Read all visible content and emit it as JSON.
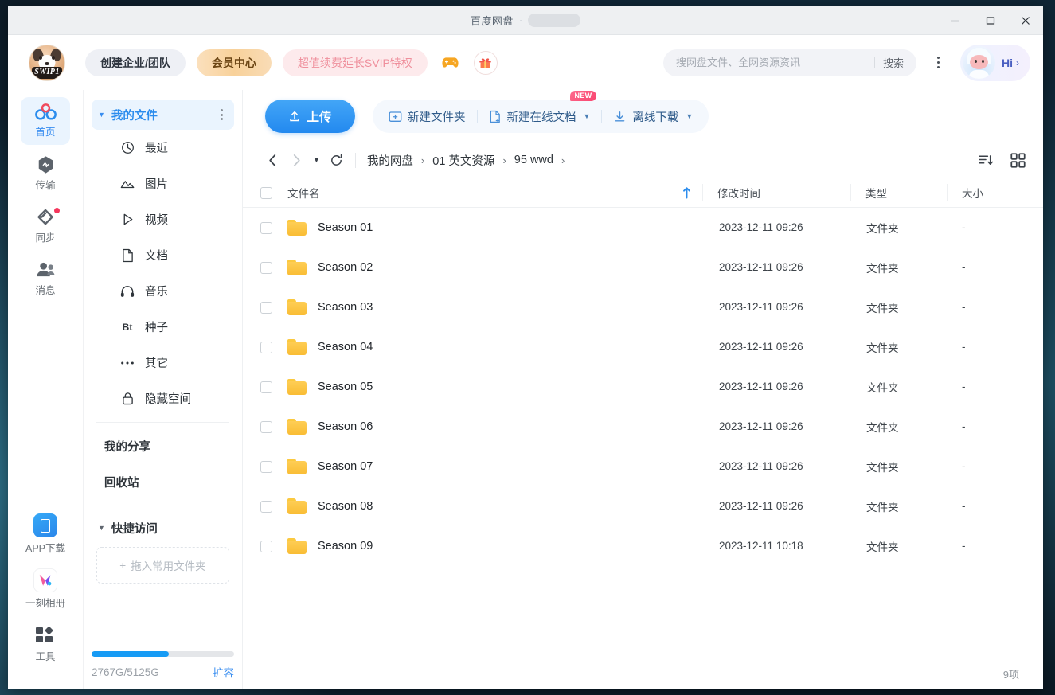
{
  "window": {
    "title": "百度网盘",
    "title_separator": "·",
    "title_redacted": true,
    "controls": {
      "minimize": "minimize-icon",
      "maximize": "maximize-icon",
      "close": "close-icon"
    }
  },
  "header": {
    "logo_text": "SWIP1",
    "buttons": [
      {
        "label": "创建企业/团队",
        "name": "create-team-button"
      },
      {
        "label": "会员中心",
        "name": "member-center-button"
      },
      {
        "label": "超值续费延长SVIP特权",
        "name": "svip-renew-button"
      }
    ],
    "game_icon": "gamepad-icon",
    "gift_icon": "gift-icon",
    "search": {
      "placeholder": "搜网盘文件、全网资源资讯",
      "value": "",
      "button_label": "搜索"
    },
    "more_label": "more-options",
    "user": {
      "greeting": "Hi",
      "arrow": "›"
    }
  },
  "rail": {
    "items": [
      {
        "label": "首页",
        "icon": "home-icon",
        "active": true,
        "badge": false
      },
      {
        "label": "传输",
        "icon": "transfer-icon",
        "active": false,
        "badge": false
      },
      {
        "label": "同步",
        "icon": "sync-icon",
        "active": false,
        "badge": true
      },
      {
        "label": "消息",
        "icon": "message-icon",
        "active": false,
        "badge": false
      }
    ],
    "bottom_items": [
      {
        "label": "APP下载",
        "icon": "app-download-icon"
      },
      {
        "label": "一刻相册",
        "icon": "album-icon"
      },
      {
        "label": "工具",
        "icon": "tools-icon"
      }
    ]
  },
  "sidebar": {
    "header": {
      "label": "我的文件",
      "expanded": true
    },
    "items": [
      {
        "label": "最近",
        "icon": "clock-icon"
      },
      {
        "label": "图片",
        "icon": "image-icon"
      },
      {
        "label": "视频",
        "icon": "video-icon"
      },
      {
        "label": "文档",
        "icon": "document-icon"
      },
      {
        "label": "音乐",
        "icon": "music-icon"
      },
      {
        "label": "种子",
        "icon": "bt-icon",
        "icon_text": "Bt"
      },
      {
        "label": "其它",
        "icon": "ellipsis-icon"
      },
      {
        "label": "隐藏空间",
        "icon": "lock-icon"
      }
    ],
    "plain_items": [
      {
        "label": "我的分享",
        "name": "sidebar-item-my-shares"
      },
      {
        "label": "回收站",
        "name": "sidebar-item-recycle-bin"
      }
    ],
    "quick_access": {
      "label": "快捷访问",
      "expanded": true,
      "dropzone_label": "拖入常用文件夹",
      "dropzone_plus": "+"
    },
    "quota": {
      "used": "2767G",
      "total": "5125G",
      "text": "2767G/5125G",
      "percent": 54,
      "expand_label": "扩容"
    }
  },
  "toolbar": {
    "upload_label": "上传",
    "upload_icon": "upload-icon",
    "new_folder_label": "新建文件夹",
    "new_folder_icon": "new-folder-icon",
    "new_doc_label": "新建在线文档",
    "new_doc_icon": "new-document-icon",
    "new_doc_badge": "NEW",
    "offline_download_label": "离线下载",
    "offline_download_icon": "download-icon"
  },
  "breadcrumb": {
    "back_icon": "chevron-left-icon",
    "forward_icon": "chevron-right-icon",
    "history_icon": "chevron-down-icon",
    "refresh_icon": "refresh-icon",
    "items": [
      "我的网盘",
      "01 英文资源",
      "95 wwd"
    ],
    "arrow": "›",
    "view": {
      "list_icon": "list-sort-icon",
      "grid_icon": "grid-view-icon"
    }
  },
  "table": {
    "columns": [
      {
        "key": "name",
        "label": "文件名",
        "sorted": true,
        "sort_dir": "asc"
      },
      {
        "key": "mtime",
        "label": "修改时间"
      },
      {
        "key": "type",
        "label": "类型"
      },
      {
        "key": "size",
        "label": "大小"
      }
    ],
    "rows": [
      {
        "name": "Season 01",
        "mtime": "2023-12-11 09:26",
        "type": "文件夹",
        "size": "-",
        "icon": "folder-icon",
        "checked": false
      },
      {
        "name": "Season 02",
        "mtime": "2023-12-11 09:26",
        "type": "文件夹",
        "size": "-",
        "icon": "folder-icon",
        "checked": false
      },
      {
        "name": "Season 03",
        "mtime": "2023-12-11 09:26",
        "type": "文件夹",
        "size": "-",
        "icon": "folder-icon",
        "checked": false
      },
      {
        "name": "Season 04",
        "mtime": "2023-12-11 09:26",
        "type": "文件夹",
        "size": "-",
        "icon": "folder-icon",
        "checked": false
      },
      {
        "name": "Season 05",
        "mtime": "2023-12-11 09:26",
        "type": "文件夹",
        "size": "-",
        "icon": "folder-icon",
        "checked": false
      },
      {
        "name": "Season 06",
        "mtime": "2023-12-11 09:26",
        "type": "文件夹",
        "size": "-",
        "icon": "folder-icon",
        "checked": false
      },
      {
        "name": "Season 07",
        "mtime": "2023-12-11 09:26",
        "type": "文件夹",
        "size": "-",
        "icon": "folder-icon",
        "checked": false
      },
      {
        "name": "Season 08",
        "mtime": "2023-12-11 09:26",
        "type": "文件夹",
        "size": "-",
        "icon": "folder-icon",
        "checked": false
      },
      {
        "name": "Season 09",
        "mtime": "2023-12-11 10:18",
        "type": "文件夹",
        "size": "-",
        "icon": "folder-icon",
        "checked": false
      }
    ],
    "select_all_checked": false
  },
  "statusbar": {
    "count_label": "9项"
  },
  "colors": {
    "accent_blue": "#2b8ced",
    "upload_blue": "#2389ef",
    "folder_yellow": "#f9bd34",
    "badge_red": "#f9456f",
    "vip_gold": "#f8d19a",
    "svip_pink": "#ef8f9c"
  }
}
